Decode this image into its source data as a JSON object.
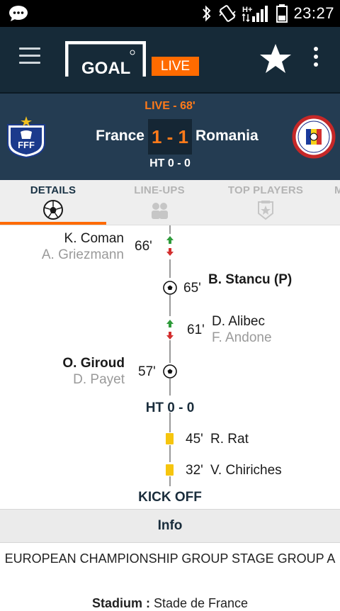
{
  "status_bar": {
    "time": "23:27",
    "network": "H+",
    "icons": [
      "message-icon",
      "bluetooth-icon",
      "vibrate-icon",
      "signal-icon",
      "battery-icon"
    ]
  },
  "app_bar": {
    "logo_text": "GOAL",
    "live_badge": "LIVE",
    "icons": [
      "menu-icon",
      "favorite-star-icon",
      "overflow-menu-icon"
    ]
  },
  "match": {
    "status": "LIVE - 68'",
    "home_team": "France",
    "away_team": "Romania",
    "score": "1 - 1",
    "half_time": "HT 0 - 0"
  },
  "tabs": [
    {
      "label": "DETAILS",
      "icon": "soccer-ball-icon",
      "active": true
    },
    {
      "label": "LINE-UPS",
      "icon": "players-icon",
      "active": false
    },
    {
      "label": "TOP PLAYERS",
      "icon": "top-player-badge-icon",
      "active": false
    },
    {
      "label": "M",
      "active": false
    }
  ],
  "events": [
    {
      "side": "home",
      "type": "substitution",
      "minute": "66'",
      "player_in": "K. Coman",
      "player_out": "A. Griezmann"
    },
    {
      "side": "away",
      "type": "goal",
      "minute": "65'",
      "player": "B. Stancu (P)"
    },
    {
      "side": "away",
      "type": "substitution",
      "minute": "61'",
      "player_in": "D. Alibec",
      "player_out": "F. Andone"
    },
    {
      "side": "home",
      "type": "goal",
      "minute": "57'",
      "player": "O. Giroud",
      "assist": "D. Payet"
    }
  ],
  "ht_marker": "HT 0 - 0",
  "first_half_events": [
    {
      "side": "away",
      "type": "yellow-card",
      "minute": "45'",
      "player": "R. Rat"
    },
    {
      "side": "away",
      "type": "yellow-card",
      "minute": "32'",
      "player": "V. Chiriches"
    }
  ],
  "kickoff_marker": "KICK OFF",
  "info": {
    "header": "Info",
    "competition": "EUROPEAN CHAMPIONSHIP GROUP STAGE GROUP A",
    "stadium_label": "Stadium :",
    "stadium_value": "Stade de France"
  },
  "colors": {
    "accent": "#ff6b00",
    "app_bar": "#162a38",
    "score_bar": "#243c52",
    "yellow_card": "#f6c50e",
    "sub_in": "#2e9b3a",
    "sub_out": "#d32f2f"
  }
}
